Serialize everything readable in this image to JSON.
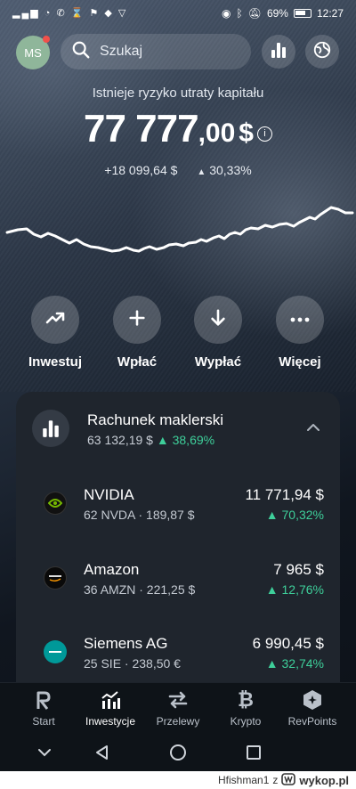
{
  "status_bar": {
    "time": "12:27",
    "battery": "69%"
  },
  "header": {
    "avatar_initials": "MS",
    "search_placeholder": "Szukaj"
  },
  "summary": {
    "risk_notice": "Istnieje ryzyko utraty kapitału",
    "balance_int": "77 777",
    "balance_dec": ",00",
    "currency": "$",
    "gain_abs": "+18 099,64 $",
    "gain_pct": "30,33%"
  },
  "actions": [
    {
      "label": "Inwestuj",
      "icon": "trend-up-icon"
    },
    {
      "label": "Wpłać",
      "icon": "plus-icon"
    },
    {
      "label": "Wypłać",
      "icon": "arrow-down-icon"
    },
    {
      "label": "Więcej",
      "icon": "more-icon"
    }
  ],
  "account": {
    "title": "Rachunek maklerski",
    "value": "63 132,19 $",
    "change_pct": "38,69%",
    "holdings": [
      {
        "name": "NVIDIA",
        "meta": "62 NVDA · 189,87 $",
        "value": "11 771,94 $",
        "change_pct": "70,32%",
        "logo_color": "#111111",
        "logo_accent": "#76b900"
      },
      {
        "name": "Amazon",
        "meta": "36 AMZN · 221,25 $",
        "value": "7 965 $",
        "change_pct": "12,76%",
        "logo_color": "#0a0a0a",
        "logo_accent": "#ff9900"
      },
      {
        "name": "Siemens AG",
        "meta": "25 SIE · 238,50 €",
        "value": "6 990,45 $",
        "change_pct": "32,74%",
        "logo_color": "#009999",
        "logo_accent": "#ffffff"
      }
    ]
  },
  "bottom_nav": [
    {
      "label": "Start",
      "icon": "revolut-r-icon",
      "active": false
    },
    {
      "label": "Inwestycje",
      "icon": "bar-chart-icon",
      "active": true
    },
    {
      "label": "Przelewy",
      "icon": "transfer-arrows-icon",
      "active": false
    },
    {
      "label": "Krypto",
      "icon": "bitcoin-icon",
      "active": false
    },
    {
      "label": "RevPoints",
      "icon": "revpoints-hex-icon",
      "active": false
    }
  ],
  "watermark": {
    "user": "Hfishman1",
    "prefix": "z",
    "site": "wykop.pl"
  },
  "colors": {
    "positive": "#3ecf9a",
    "card": "#1f252d",
    "nav": "#0e1318"
  }
}
